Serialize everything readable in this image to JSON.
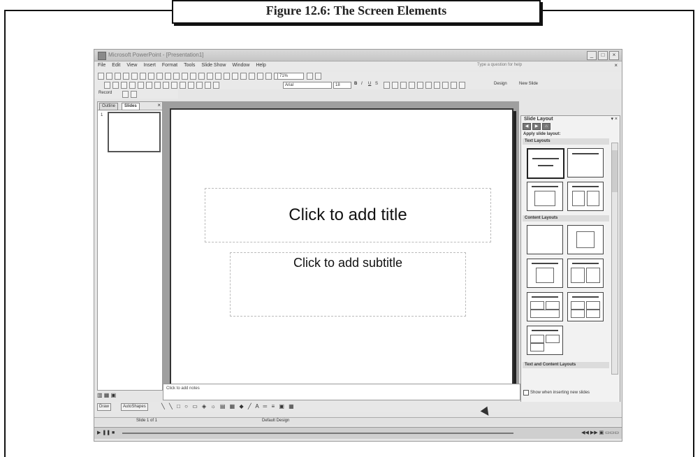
{
  "caption": "Figure 12.6: The Screen Elements",
  "window": {
    "title": "Microsoft PowerPoint - [Presentation1]",
    "controls": [
      "_",
      "□",
      "×"
    ]
  },
  "menubar": {
    "items": [
      "File",
      "Edit",
      "View",
      "Insert",
      "Format",
      "Tools",
      "Slide Show",
      "Window",
      "Help"
    ],
    "question_placeholder": "Type a question for help",
    "close": "×"
  },
  "toolbar": {
    "zoom": "71%",
    "font": "Arial",
    "size": "18",
    "bold": "B",
    "italic": "I",
    "underline": "U",
    "shadow": "S",
    "design": "Design",
    "new_slide": "New Slide",
    "record": "Record"
  },
  "left_pane": {
    "tab_outline": "Outline",
    "tab_slides": "Slides",
    "close": "×",
    "slide_number": "1"
  },
  "slide": {
    "title_placeholder": "Click to add title",
    "subtitle_placeholder": "Click to add subtitle"
  },
  "notes": "Click to add notes",
  "task_pane": {
    "title": "Slide Layout",
    "controls": "▾ ×",
    "apply": "Apply slide layout:",
    "sections": {
      "text": "Text Layouts",
      "content": "Content Layouts",
      "text_content": "Text and Content Layouts"
    },
    "show_when_inserting": "Show when inserting new slides"
  },
  "drawing": {
    "draw": "Draw",
    "autoshapes": "AutoShapes"
  },
  "status": {
    "slide": "Slide 1 of 1",
    "design": "Default Design"
  },
  "colors": {
    "workarea": "#9f9f9f",
    "chrome": "#e6e6e6"
  }
}
